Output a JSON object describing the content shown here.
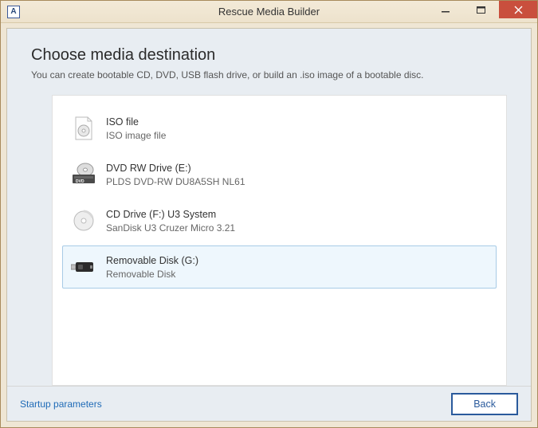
{
  "window": {
    "title": "Rescue Media Builder",
    "app_icon_letter": "A"
  },
  "header": {
    "title": "Choose media destination",
    "subtitle": "You can create bootable CD, DVD, USB flash drive, or build an .iso image of a bootable disc."
  },
  "destinations": [
    {
      "icon": "iso-file-icon",
      "title": "ISO file",
      "subtitle": "ISO image file",
      "selected": false
    },
    {
      "icon": "dvd-drive-icon",
      "title": "DVD RW Drive (E:)",
      "subtitle": "PLDS DVD-RW DU8A5SH NL61",
      "selected": false
    },
    {
      "icon": "cd-drive-icon",
      "title": "CD Drive (F:) U3 System",
      "subtitle": "SanDisk U3 Cruzer Micro 3.21",
      "selected": false
    },
    {
      "icon": "usb-drive-icon",
      "title": "Removable Disk (G:)",
      "subtitle": "Removable Disk",
      "selected": true
    }
  ],
  "footer": {
    "startup_link": "Startup parameters",
    "back_label": "Back"
  }
}
